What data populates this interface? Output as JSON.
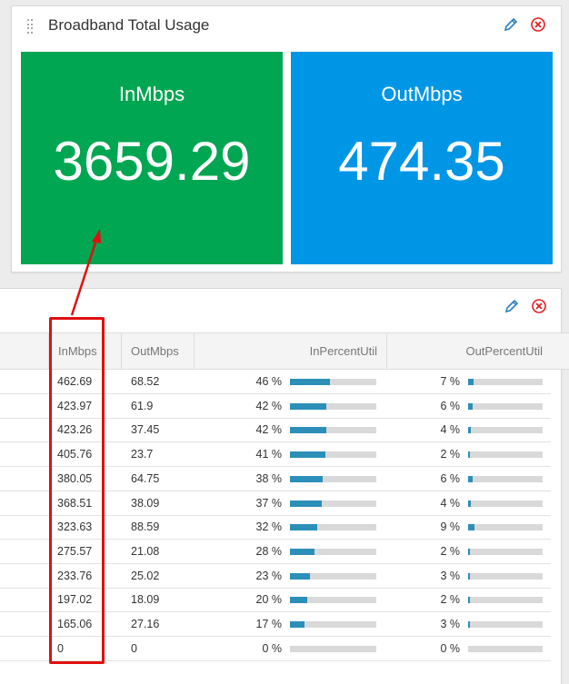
{
  "widget_top": {
    "title": "Broadband Total Usage",
    "in_tile": {
      "label": "InMbps",
      "value": "3659.29",
      "color": "#00a651"
    },
    "out_tile": {
      "label": "OutMbps",
      "value": "474.35",
      "color": "#0096e6"
    }
  },
  "table": {
    "columns": [
      "InMbps",
      "OutMbps",
      "InPercentUtil",
      "OutPercentUtil"
    ],
    "rows": [
      {
        "in": "462.69",
        "out": "68.52",
        "inp": "46 %",
        "outp": "7 %",
        "inp_val": 0.46,
        "outp_val": 0.07
      },
      {
        "in": "423.97",
        "out": "61.9",
        "inp": "42 %",
        "outp": "6 %",
        "inp_val": 0.42,
        "outp_val": 0.06
      },
      {
        "in": "423.26",
        "out": "37.45",
        "inp": "42 %",
        "outp": "4 %",
        "inp_val": 0.42,
        "outp_val": 0.04
      },
      {
        "in": "405.76",
        "out": "23.7",
        "inp": "41 %",
        "outp": "2 %",
        "inp_val": 0.41,
        "outp_val": 0.02
      },
      {
        "in": "380.05",
        "out": "64.75",
        "inp": "38 %",
        "outp": "6 %",
        "inp_val": 0.38,
        "outp_val": 0.06
      },
      {
        "in": "368.51",
        "out": "38.09",
        "inp": "37 %",
        "outp": "4 %",
        "inp_val": 0.37,
        "outp_val": 0.04
      },
      {
        "in": "323.63",
        "out": "88.59",
        "inp": "32 %",
        "outp": "9 %",
        "inp_val": 0.32,
        "outp_val": 0.09
      },
      {
        "in": "275.57",
        "out": "21.08",
        "inp": "28 %",
        "outp": "2 %",
        "inp_val": 0.28,
        "outp_val": 0.02
      },
      {
        "in": "233.76",
        "out": "25.02",
        "inp": "23 %",
        "outp": "3 %",
        "inp_val": 0.23,
        "outp_val": 0.03
      },
      {
        "in": "197.02",
        "out": "18.09",
        "inp": "20 %",
        "outp": "2 %",
        "inp_val": 0.2,
        "outp_val": 0.02
      },
      {
        "in": "165.06",
        "out": "27.16",
        "inp": "17 %",
        "outp": "3 %",
        "inp_val": 0.17,
        "outp_val": 0.03
      },
      {
        "in": "0",
        "out": "0",
        "inp": "0 %",
        "outp": "0 %",
        "inp_val": 0.0,
        "outp_val": 0.0
      }
    ]
  },
  "icons": {
    "edit": "pencil-icon",
    "close": "close-circle-icon"
  },
  "colors": {
    "bar_fill": "#2b8fb8",
    "highlight": "#e01010"
  }
}
